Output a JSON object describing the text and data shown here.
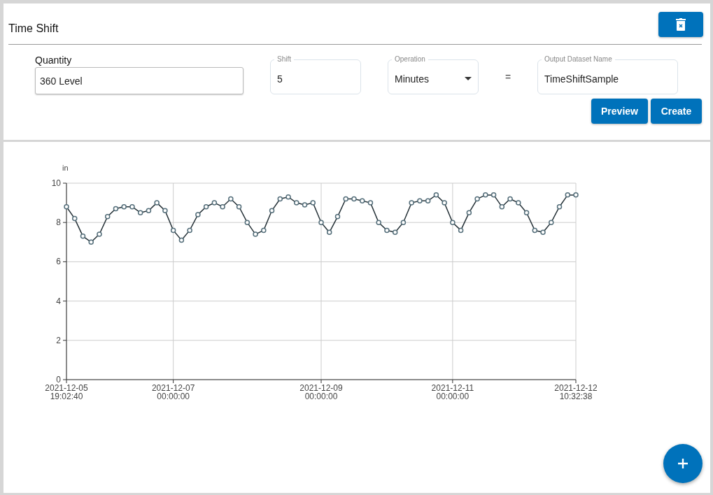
{
  "panel": {
    "title": "Time Shift"
  },
  "quantity": {
    "label": "Quantity",
    "value": "360 Level"
  },
  "shift": {
    "label": "Shift",
    "value": "5"
  },
  "operation": {
    "label": "Operation",
    "value": "Minutes"
  },
  "equals": "=",
  "output": {
    "label": "Output Dataset Name",
    "value": "TimeShiftSample"
  },
  "buttons": [
    "Preview",
    "Create"
  ],
  "chart": {
    "chart_data": {
      "type": "line",
      "ylabel": "in",
      "categories": [
        "2021-12-05 19:02:40",
        null,
        null,
        null,
        null,
        null,
        null,
        null,
        null,
        null,
        null,
        null,
        null,
        "2021-12-07 00:00:00",
        null,
        null,
        null,
        null,
        null,
        null,
        null,
        null,
        null,
        null,
        null,
        null,
        null,
        null,
        null,
        null,
        null,
        "2021-12-09 00:00:00",
        null,
        null,
        null,
        null,
        null,
        null,
        null,
        null,
        null,
        null,
        null,
        null,
        null,
        null,
        null,
        "2021-12-11 00:00:00",
        null,
        null,
        null,
        null,
        null,
        null,
        null,
        null,
        null,
        null,
        null,
        null,
        null,
        null,
        "2021-12-12 10:32:38"
      ],
      "grid": true,
      "series": [
        {
          "color": "#546e7a",
          "marker": true,
          "values": [
            8.8,
            8.2,
            7.3,
            7.0,
            7.4,
            8.3,
            8.7,
            8.8,
            8.8,
            8.5,
            8.6,
            9.0,
            8.6,
            7.6,
            7.1,
            7.6,
            8.4,
            8.8,
            9.0,
            8.8,
            9.2,
            8.8,
            8.0,
            7.4,
            7.6,
            8.6,
            9.2,
            9.3,
            9.0,
            8.9,
            9.0,
            8.0,
            7.5,
            8.3,
            9.2,
            9.2,
            9.1,
            9.0,
            8.0,
            7.6,
            7.5,
            8.0,
            9.0,
            9.1,
            9.1,
            9.4,
            9.0,
            8.0,
            7.6,
            8.5,
            9.2,
            9.4,
            9.4,
            8.8,
            9.2,
            9.0,
            8.5,
            7.6,
            7.5,
            8.0,
            8.8,
            9.4,
            9.4
          ]
        }
      ],
      "ylim": [
        0,
        10
      ],
      "yticks": [
        0,
        2,
        4,
        6,
        8,
        10
      ]
    }
  }
}
